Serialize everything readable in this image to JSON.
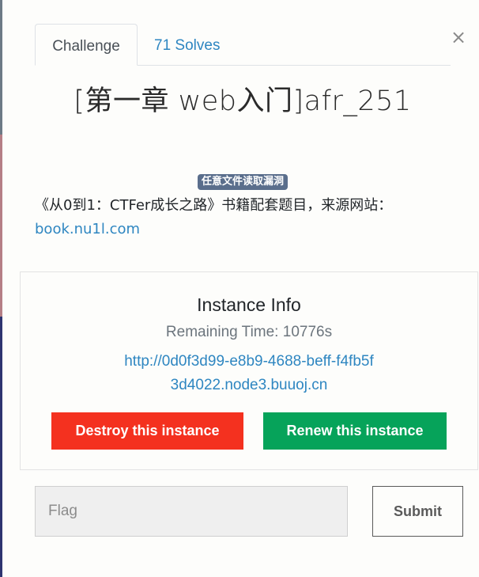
{
  "modal": {
    "close_symbol": "×",
    "tabs": [
      {
        "label": "Challenge"
      },
      {
        "label": "71 Solves"
      }
    ],
    "title": "[第一章 web入门]afr_251",
    "tag": "任意文件读取漏洞",
    "description": {
      "text": "《从0到1：CTFer成长之路》书籍配套题目，来源网站：",
      "link": "book.nu1l.com"
    }
  },
  "instance": {
    "title": "Instance Info",
    "remaining_label": "Remaining Time:",
    "remaining_value": "10776s",
    "url": "http://0d0f3d99-e8b9-4688-beff-f4fb5f3d4022.node3.buuoj.cn",
    "destroy_label": "Destroy this instance",
    "renew_label": "Renew this instance"
  },
  "flag": {
    "placeholder": "Flag",
    "value": "",
    "submit_label": "Submit"
  },
  "colors": {
    "accent": "#2e86c1",
    "destroy": "#f4311f",
    "renew": "#06a35a",
    "tag_bg": "#5a6e8c"
  }
}
